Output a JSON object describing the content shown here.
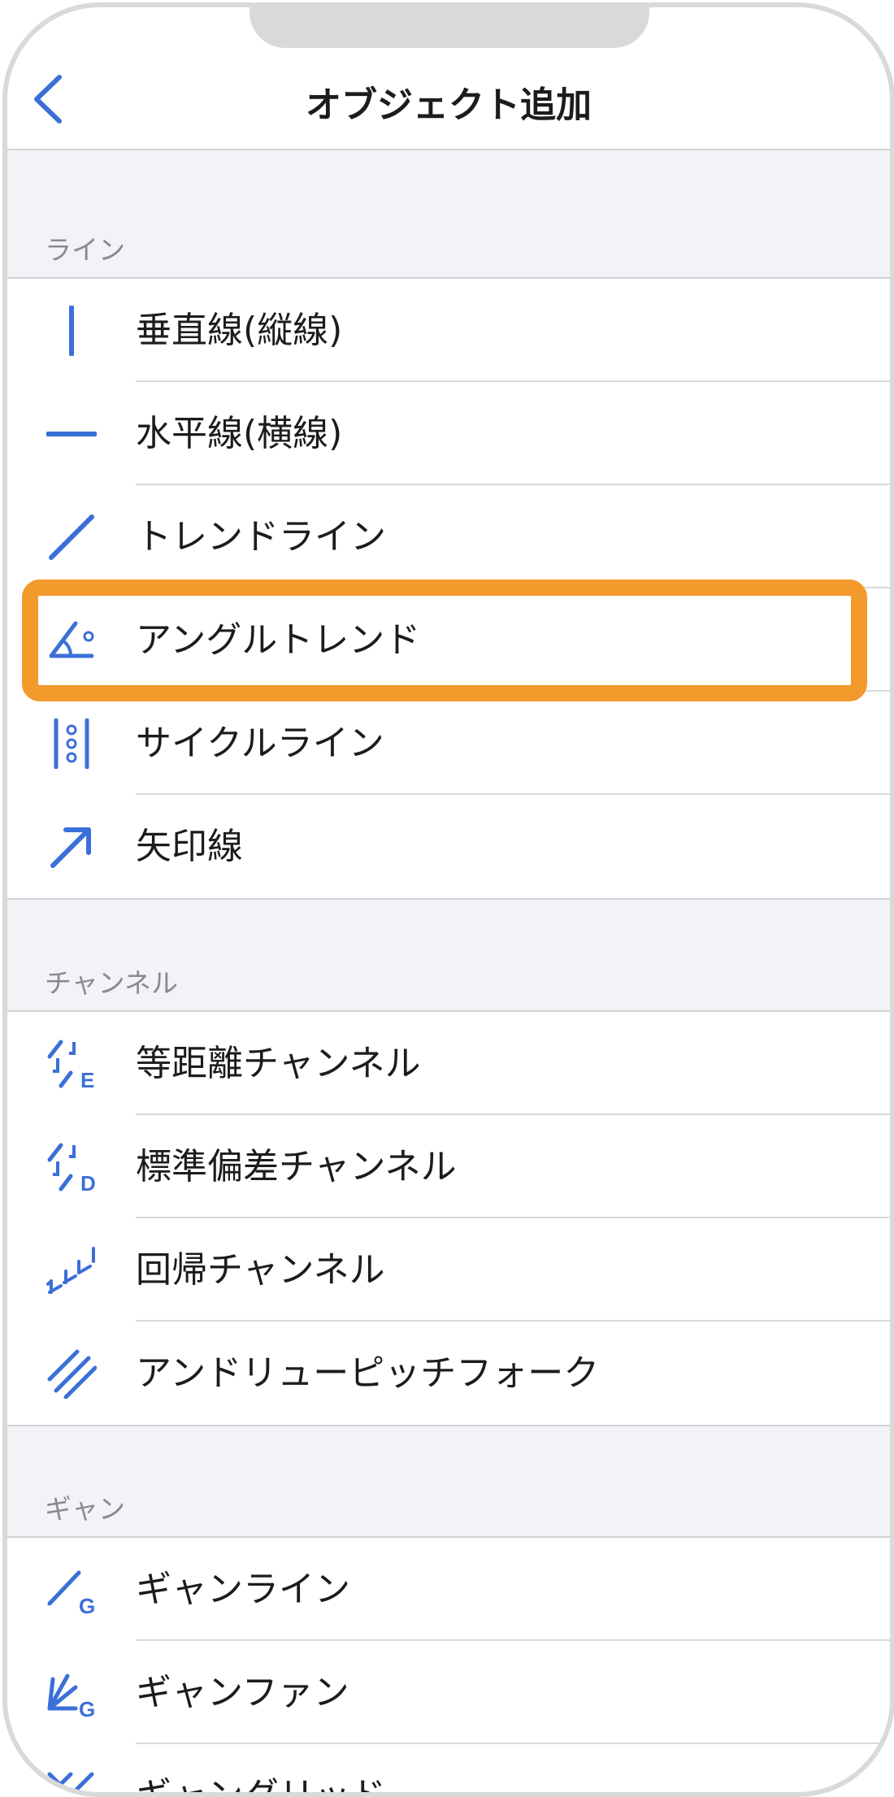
{
  "header": {
    "title": "オブジェクト追加"
  },
  "sections": [
    {
      "title": "ライン",
      "items": [
        {
          "label": "垂直線(縦線)",
          "icon": "vertical-line-icon"
        },
        {
          "label": "水平線(横線)",
          "icon": "horizontal-line-icon"
        },
        {
          "label": "トレンドライン",
          "icon": "trendline-icon"
        },
        {
          "label": "アングルトレンド",
          "icon": "angle-trend-icon",
          "highlighted": true
        },
        {
          "label": "サイクルライン",
          "icon": "cycle-lines-icon"
        },
        {
          "label": "矢印線",
          "icon": "arrow-line-icon"
        }
      ]
    },
    {
      "title": "チャンネル",
      "items": [
        {
          "label": "等距離チャンネル",
          "icon": "equidistant-channel-icon",
          "icon_letter": "E"
        },
        {
          "label": "標準偏差チャンネル",
          "icon": "std-deviation-channel-icon",
          "icon_letter": "D"
        },
        {
          "label": "回帰チャンネル",
          "icon": "regression-channel-icon"
        },
        {
          "label": "アンドリューピッチフォーク",
          "icon": "andrews-pitchfork-icon"
        }
      ]
    },
    {
      "title": "ギャン",
      "items": [
        {
          "label": "ギャンライン",
          "icon": "gann-line-icon",
          "icon_letter": "G"
        },
        {
          "label": "ギャンファン",
          "icon": "gann-fan-icon",
          "icon_letter": "G"
        },
        {
          "label": "ギャングリッド",
          "icon": "gann-grid-icon"
        }
      ]
    }
  ],
  "colors": {
    "accent": "#3b6fd8",
    "highlight": "#f29a2c",
    "background": "#f2f2f7",
    "separator": "#d1d1d6"
  }
}
